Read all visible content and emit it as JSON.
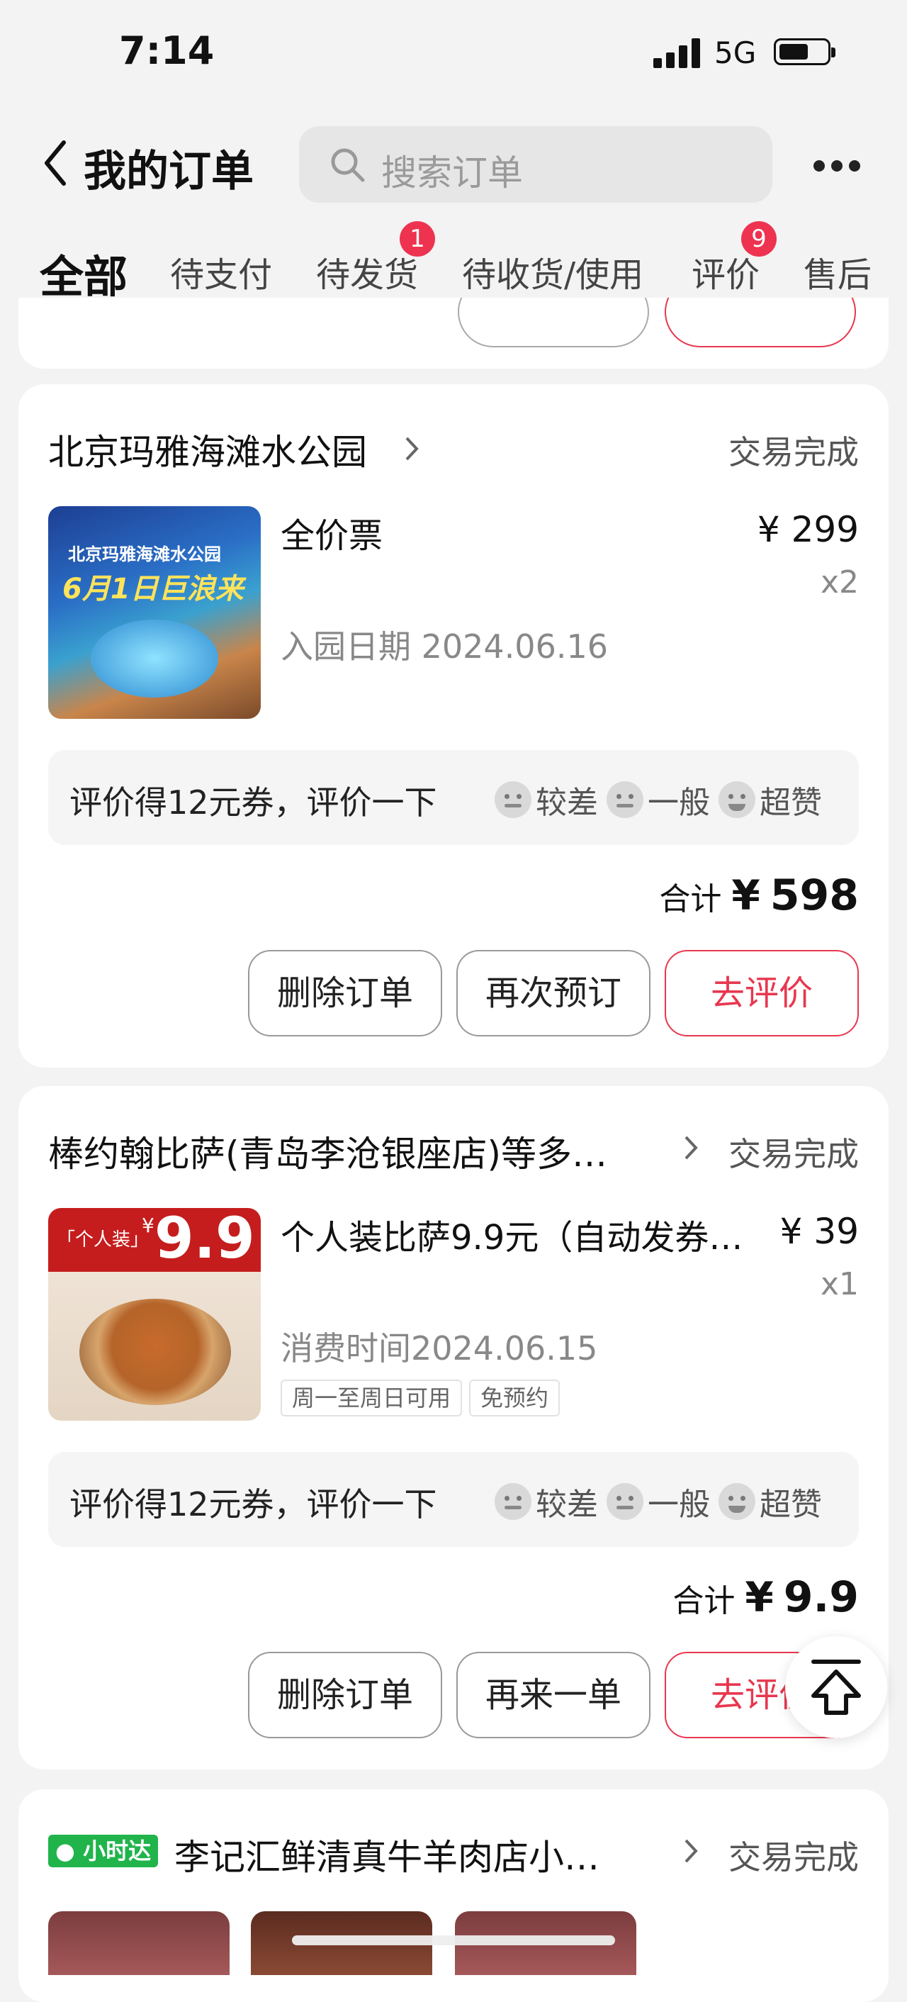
{
  "status_bar": {
    "time": "7:14",
    "network": "5G"
  },
  "header": {
    "title": "我的订单",
    "search_placeholder": "搜索订单"
  },
  "tabs": [
    {
      "label": "全部"
    },
    {
      "label": "待支付"
    },
    {
      "label": "待发货",
      "badge": "1"
    },
    {
      "label": "待收货/使用"
    },
    {
      "label": "评价",
      "badge": "9"
    },
    {
      "label": "售后"
    }
  ],
  "orders": [
    {
      "shop": "北京玛雅海滩水公园",
      "status": "交易完成",
      "item": "全价票",
      "price": "¥ 299",
      "qty": "x2",
      "date": "入园日期  2024.06.16",
      "thumb_text": {
        "line1": "北京玛雅海滩水公园",
        "line2": "6月1日巨浪来"
      },
      "review": {
        "text": "评价得12元券，评价一下",
        "bad": "较差",
        "ok": "一般",
        "good": "超赞"
      },
      "total_label": "合计",
      "total_currency": "¥",
      "total": "598",
      "buttons": [
        "删除订单",
        "再次预订",
        "去评价"
      ]
    },
    {
      "shop": "棒约翰比萨(青岛李沧银座店)等多…",
      "status": "交易完成",
      "item": "个人装比萨9.9元（自动发券…",
      "price": "¥ 39",
      "qty": "x1",
      "date": "消费时间2024.06.15",
      "tags": [
        "周一至周日可用",
        "免预约"
      ],
      "thumb_text": {
        "line1": "「个人装」",
        "currency": "¥",
        "price": "9.9"
      },
      "review": {
        "text": "评价得12元券，评价一下",
        "bad": "较差",
        "ok": "一般",
        "good": "超赞"
      },
      "total_label": "合计",
      "total_currency": "¥",
      "total": "9.9",
      "buttons": [
        "删除订单",
        "再来一单",
        "去评价"
      ]
    },
    {
      "badge": "小时达",
      "shop": "李记汇鲜清真牛羊肉店小…",
      "status": "交易完成"
    }
  ],
  "colors": {
    "accent": "#e8374f",
    "badge": "#ee3350",
    "green": "#20b44b"
  }
}
